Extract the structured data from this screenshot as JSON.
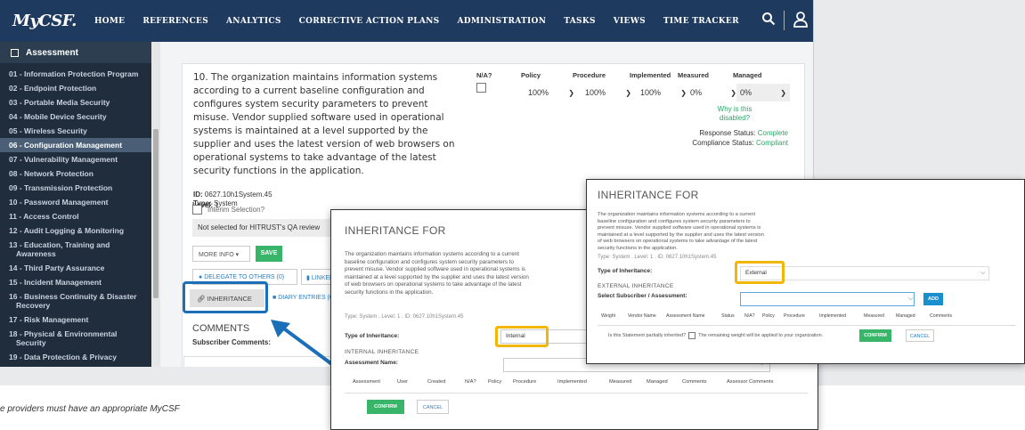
{
  "nav": {
    "logo": "MyCSF.",
    "items": [
      "HOME",
      "REFERENCES",
      "ANALYTICS",
      "CORRECTIVE ACTION PLANS",
      "ADMINISTRATION",
      "TASKS",
      "VIEWS",
      "TIME TRACKER"
    ]
  },
  "sidebar": {
    "header": "Assessment",
    "items": [
      "01 - Information Protection Program",
      "02 - Endpoint Protection",
      "03 - Portable Media Security",
      "04 - Mobile Device Security",
      "05 - Wireless Security",
      "06 - Configuration Management",
      "07 - Vulnerability Management",
      "08 - Network Protection",
      "09 - Transmission Protection",
      "10 - Password Management",
      "11 - Access Control",
      "12 - Audit Logging & Monitoring",
      "13 - Education, Training and",
      "Awareness",
      "14 - Third Party Assurance",
      "15 - Incident Management",
      "16 - Business Continuity & Disaster",
      "Recovery",
      "17 - Risk Management",
      "18 - Physical & Environmental",
      "Security",
      "19 - Data Protection & Privacy"
    ]
  },
  "question": {
    "text": "10. The organization maintains information systems according to a current baseline configuration and configures system security parameters to prevent misuse. Vendor supplied software used in operational systems is maintained at a level supported by the supplier and uses the latest version of web browsers on operational systems to take advantage of the latest security functions in the application.",
    "id_label": "ID:",
    "id": "0627.10h1System.45",
    "type_label": "Type:",
    "type": "System",
    "level_label": "Level:",
    "level": "1"
  },
  "scores": {
    "na_label": "N/A?",
    "policy_label": "Policy",
    "policy": "100%",
    "procedure_label": "Procedure",
    "procedure": "100%",
    "implemented_label": "Implemented",
    "implemented": "100%",
    "measured_label": "Measured",
    "measured": "0%",
    "managed_label": "Managed",
    "managed": "0%",
    "why_disabled": "Why is this disabled?"
  },
  "status": {
    "response_label": "Response Status:",
    "response": "Complete",
    "compliance_label": "Compliance Status:",
    "compliance": "Compliant"
  },
  "actions": {
    "interim": "Interim Selection?",
    "not_selected": "Not selected for HITRUST's QA review",
    "more_info": "MORE INFO",
    "save": "SAVE",
    "delegate": "DELEGATE TO OTHERS (0)",
    "linked": "LINKED",
    "inheritance": "INHERITANCE",
    "diary": "DIARY ENTRIES (0)",
    "comments_heading": "COMMENTS",
    "subscriber_comments": "Subscriber Comments:"
  },
  "caption": "e providers must have an appropriate MyCSF",
  "modal_internal": {
    "title": "INHERITANCE FOR",
    "desc": "The organization maintains information systems according to a current baseline configuration and configures system security parameters to prevent misuse. Vendor supplied software used in operational systems is maintained at a level supported by the supplier and uses the latest version of web browsers on operational systems to take advantage of the latest security functions in the application.",
    "meta": "Type: System . Level: 1 . ID: 0627.10h1System.45",
    "type_label": "Type of Inheritance:",
    "type_value": "Internal",
    "section": "INTERNAL INHERITANCE",
    "assessment_label": "Assessment Name:",
    "columns": [
      "Assessment",
      "User",
      "Created",
      "N/A?",
      "Policy",
      "Procedure",
      "Implemented",
      "Measured",
      "Managed",
      "Comments",
      "Assessor Comments"
    ],
    "confirm": "CONFIRM",
    "cancel": "CANCEL"
  },
  "modal_external": {
    "title": "INHERITANCE FOR",
    "desc": "The organization maintains information systems according to a current baseline configuration and configures system security parameters to prevent misuse. Vendor supplied software used in operational systems is maintained at a level supported by the supplier and uses the latest version of web browsers on operational systems to take advantage of the latest security functions in the application.",
    "meta": "Type: System . Level: 1 . ID: 0627.10h1System.45",
    "type_label": "Type of Inheritance:",
    "type_value": "External",
    "section": "EXTERNAL INHERITANCE",
    "subscriber_label": "Select Subscriber / Assessment:",
    "add": "ADD",
    "columns": [
      "Weight",
      "Vendor Name",
      "Assessment Name",
      "Status",
      "N/A?",
      "Policy",
      "Procedure",
      "Implemented",
      "Measured",
      "Managed",
      "Comments"
    ],
    "partial": "Is this Statement partially inherited?",
    "remaining": "The remaining weight will be applied to your organization.",
    "confirm": "CONFIRM",
    "cancel": "CANCEL"
  },
  "colors": {
    "nav_bg": "#1e3a5f",
    "sidebar_bg": "#1f2d3d",
    "green": "#2ca56a",
    "highlight_blue": "#1a6fb8",
    "highlight_yellow": "#f2b705"
  }
}
